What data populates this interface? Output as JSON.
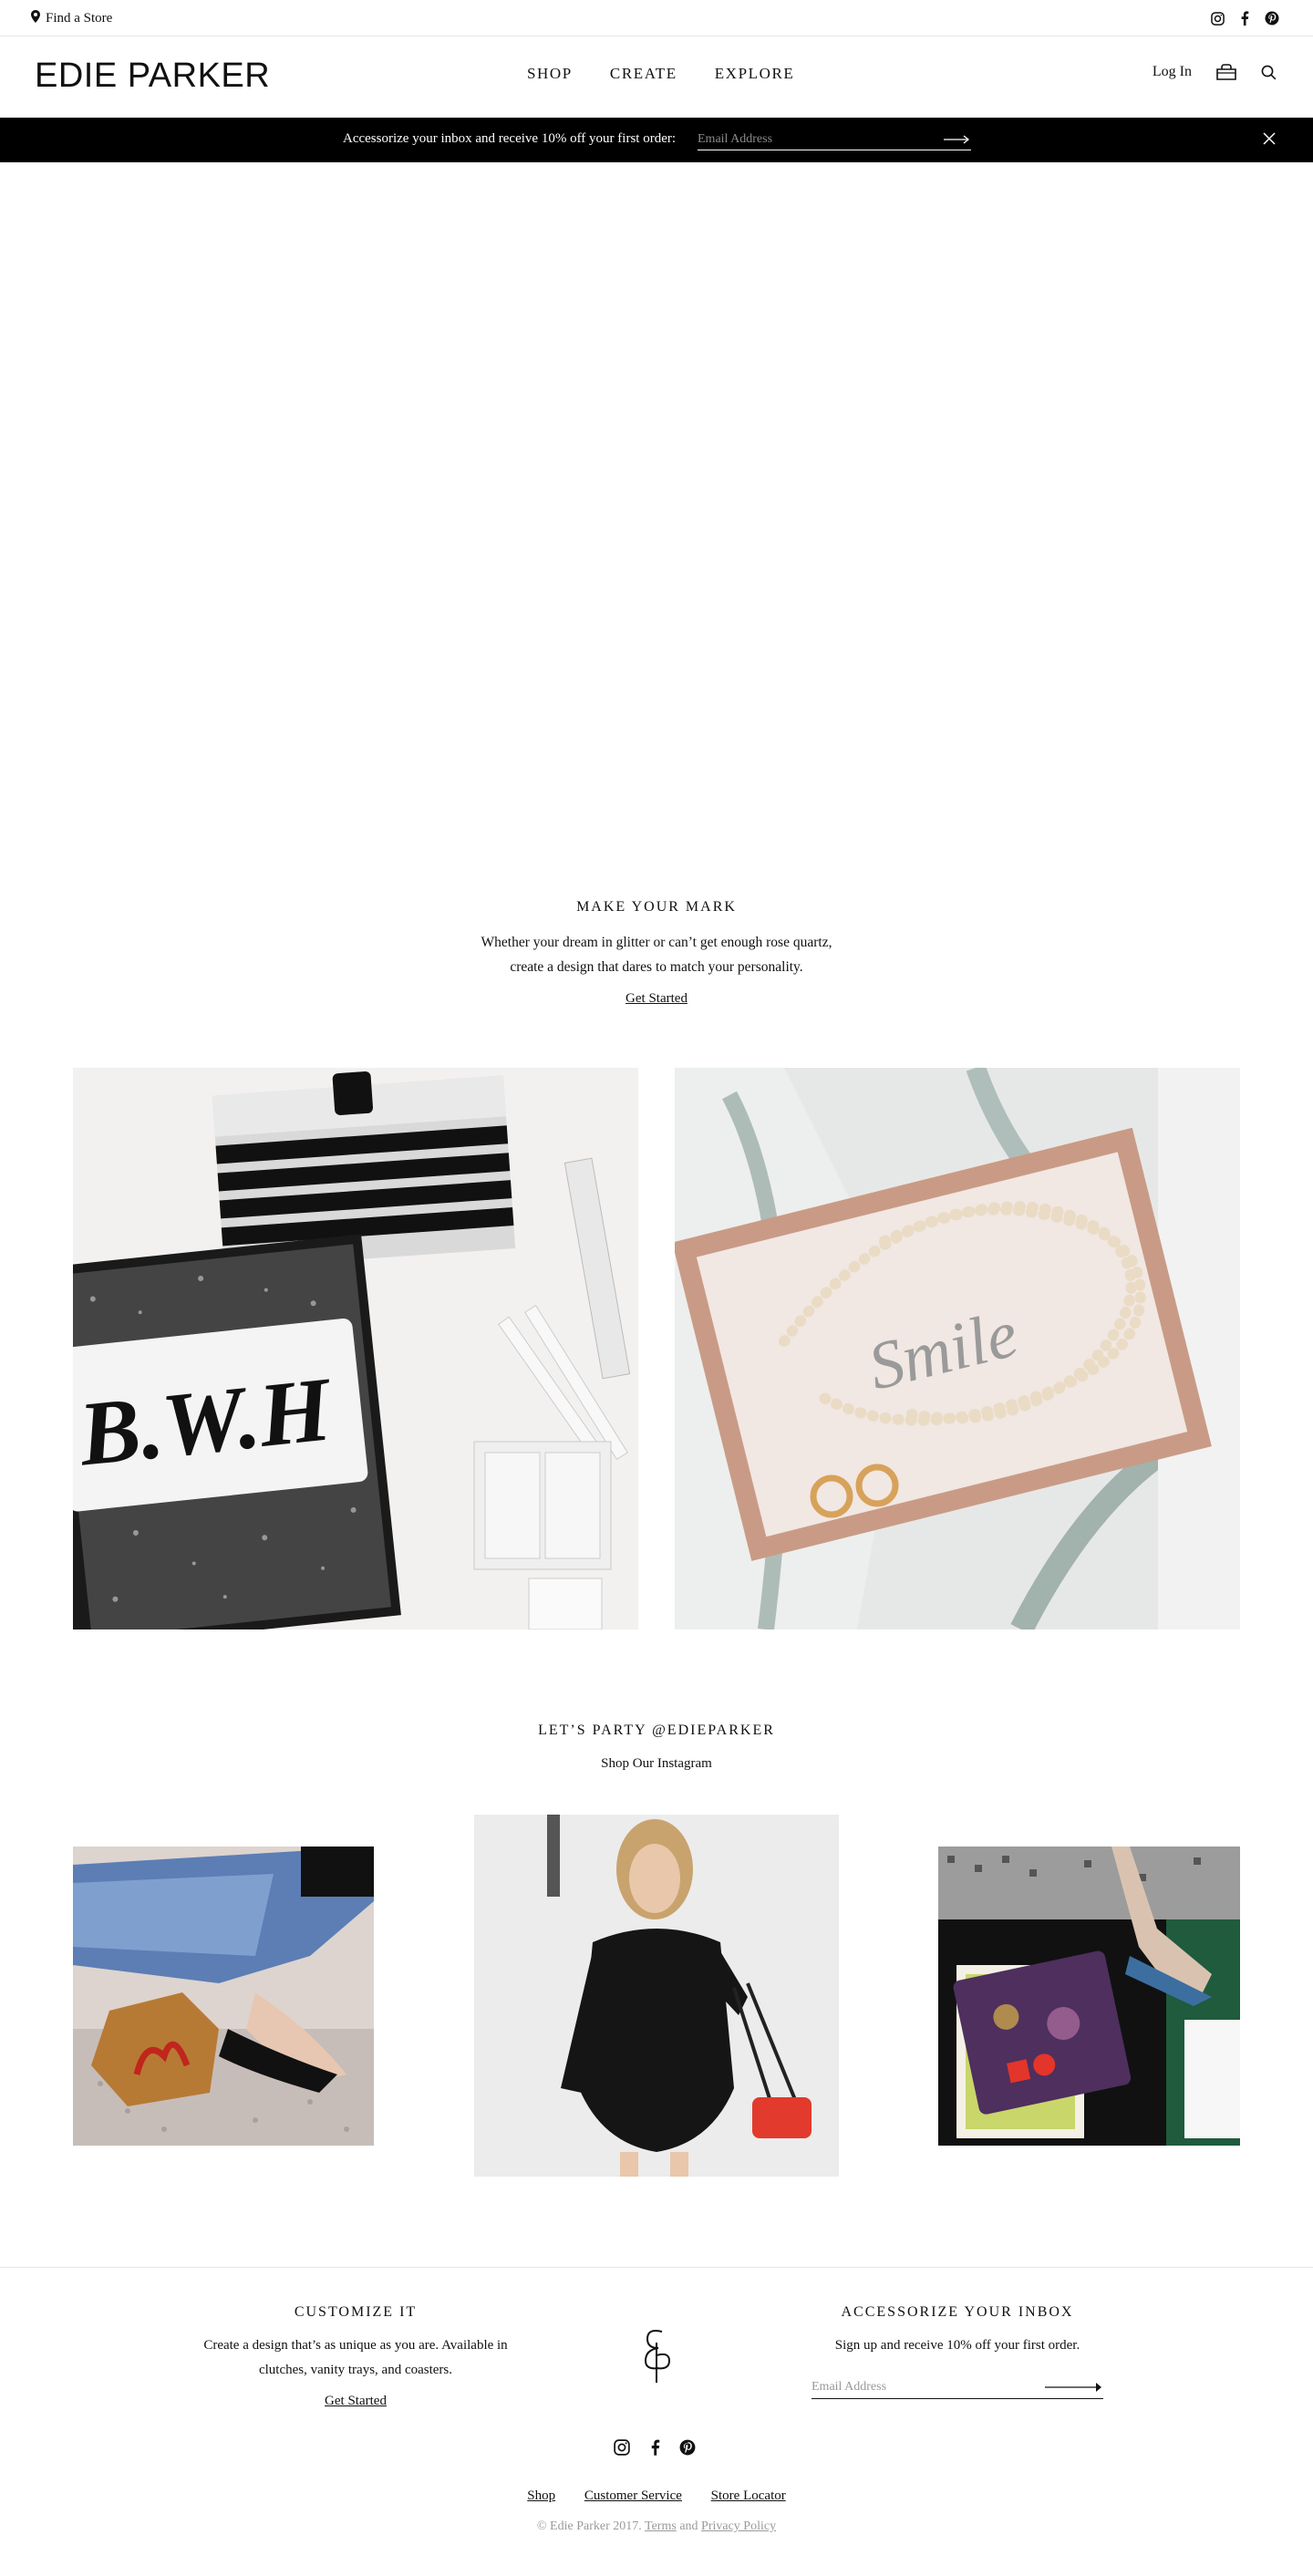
{
  "utility": {
    "find_store": "Find a Store",
    "social_icons": [
      "instagram-icon",
      "facebook-icon",
      "pinterest-icon"
    ]
  },
  "header": {
    "logo": "EDIE PARKER",
    "nav": [
      "SHOP",
      "CREATE",
      "EXPLORE"
    ],
    "login": "Log In",
    "icons": [
      "bag-icon",
      "search-icon"
    ]
  },
  "promo": {
    "text": "Accessorize your inbox and receive 10% off your first order:",
    "email_placeholder": "Email Address"
  },
  "make_your_mark": {
    "title": "MAKE YOUR MARK",
    "body_line1": "Whether your dream in glitter or can’t get enough rose quartz,",
    "body_line2": "create a design that dares to match your personality.",
    "link": "Get Started",
    "image_text_left": "B.W.H",
    "image_text_right": "Smile"
  },
  "instagram": {
    "title": "LET’S PARTY @EDIEPARKER",
    "subtitle": "Shop Our Instagram"
  },
  "footer": {
    "customize": {
      "title": "CUSTOMIZE IT",
      "line1": "Create a design that’s as unique as you are. Available in",
      "line2": "clutches, vanity trays, and coasters.",
      "link": "Get Started"
    },
    "inbox": {
      "title": "ACCESSORIZE YOUR INBOX",
      "text": "Sign up and receive 10% off your first order.",
      "email_placeholder": "Email Address"
    },
    "links": [
      "Shop",
      "Customer Service",
      "Store Locator"
    ],
    "copyright_prefix": "© Edie Parker 2017.",
    "terms": "Terms",
    "and": "and",
    "privacy": "Privacy Policy"
  },
  "colors": {
    "promo_bg": "#000000",
    "text": "#111111",
    "muted": "#9a9a9a"
  }
}
